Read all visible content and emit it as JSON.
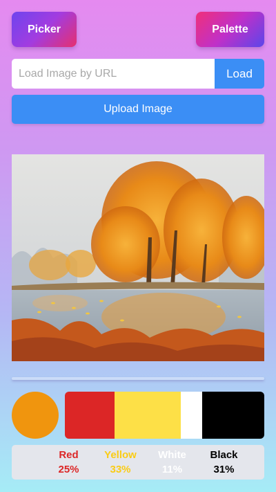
{
  "header": {
    "picker_label": "Picker",
    "palette_label": "Palette"
  },
  "url_loader": {
    "placeholder": "Load Image by URL",
    "value": "",
    "load_label": "Load"
  },
  "upload": {
    "label": "Upload Image"
  },
  "image": {
    "description_icon": "landscape-image"
  },
  "selected_color": "#f0950e",
  "palette": {
    "colors": [
      {
        "name": "Red",
        "percent": "25%",
        "color": "#dc2626",
        "text_color": "#dc2626"
      },
      {
        "name": "Yellow",
        "percent": "33%",
        "color": "#fde047",
        "text_color": "#facc15"
      },
      {
        "name": "White",
        "percent": "11%",
        "color": "#ffffff",
        "text_color": "#ffffff"
      },
      {
        "name": "Black",
        "percent": "31%",
        "color": "#000000",
        "text_color": "#000000"
      }
    ]
  }
}
